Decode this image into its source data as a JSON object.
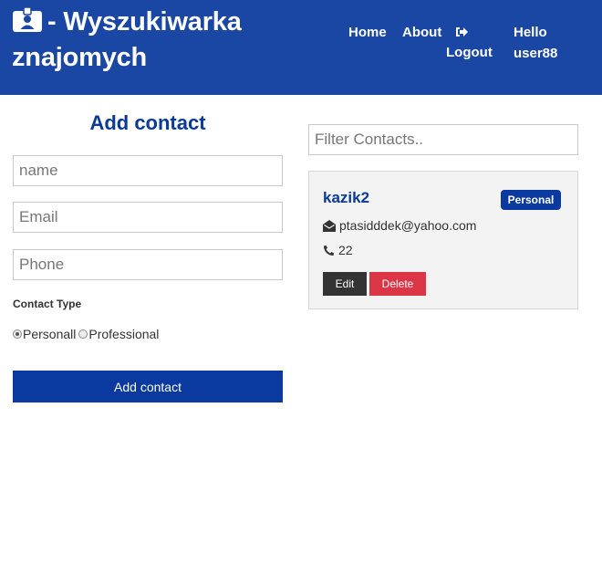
{
  "navbar": {
    "brand_line1": "- Wyszukiwarka",
    "brand_line2": "znajomych",
    "brand_icon": "id-badge-icon",
    "links": {
      "home": "Home",
      "about": "About",
      "logout": "Logout",
      "logout_icon": "sign-out-icon",
      "hello": "Hello user88"
    },
    "background": "#1a47a3"
  },
  "form": {
    "title": "Add contact",
    "name_placeholder": "name",
    "email_placeholder": "Email",
    "phone_placeholder": "Phone",
    "contact_type_label": "Contact Type",
    "radio_personal": "Personall",
    "radio_professional": "Professional",
    "selected_type": "personal",
    "submit_label": "Add contact"
  },
  "filter": {
    "placeholder": "Filter Contacts.."
  },
  "contacts": [
    {
      "name": "kazik2",
      "type_badge": "Personal",
      "email": "ptasidddek@yahoo.com",
      "phone": "22",
      "edit_label": "Edit",
      "delete_label": "Delete"
    }
  ],
  "colors": {
    "primary": "#0a3a9f",
    "danger": "#dc3545",
    "dark": "#333333"
  }
}
